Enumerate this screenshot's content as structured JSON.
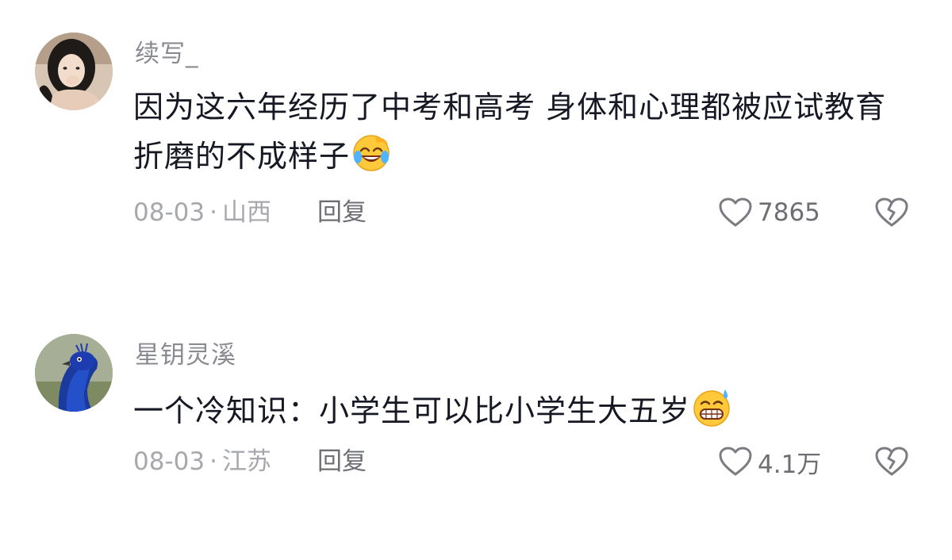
{
  "comments": [
    {
      "username": "续写_",
      "text": "因为这六年经历了中考和高考 身体和心理都被应试教育折磨的不成样子",
      "emoji": "laughing-crying-emoji",
      "date": "08-03",
      "location": "山西",
      "reply_label": "回复",
      "like_count": "7865"
    },
    {
      "username": "星钥灵溪",
      "text": "一个冷知识：小学生可以比小学生大五岁",
      "emoji": "grinning-sweat-emoji",
      "date": "08-03",
      "location": "江苏",
      "reply_label": "回复",
      "like_count": "4.1万"
    }
  ],
  "colors": {
    "username": "#8a8b91",
    "text": "#161823",
    "meta": "#a7a8ad",
    "action": "#6e6f75"
  }
}
